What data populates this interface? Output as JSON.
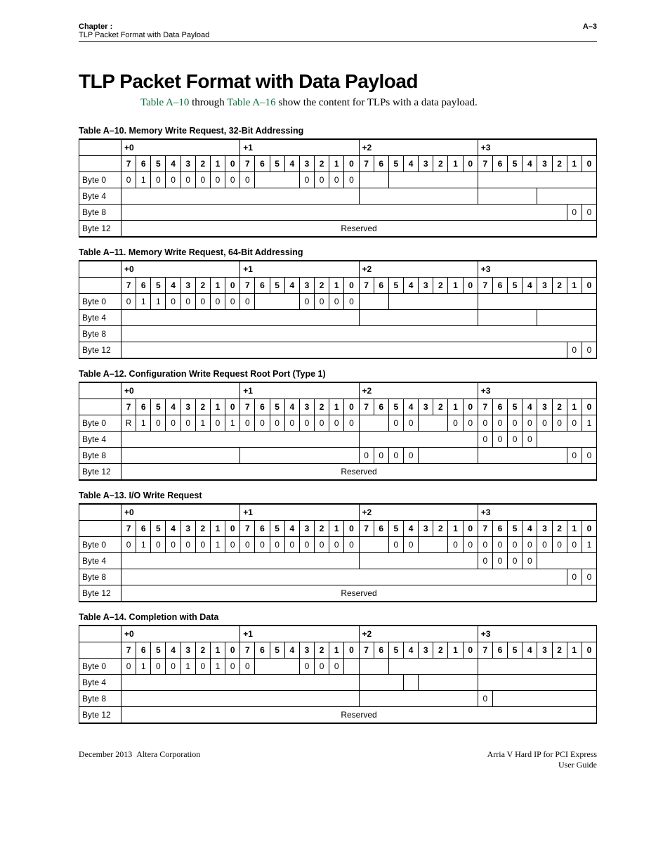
{
  "header": {
    "chapter": "Chapter :",
    "sub": "TLP Packet Format with Data Payload",
    "page": "A–3"
  },
  "title": "TLP Packet Format with Data Payload",
  "intro": {
    "ref1": "Table A–10",
    "mid": " through ",
    "ref2": "Table A–16",
    "rest": " show the content for TLPs with a data payload."
  },
  "byteGroups": [
    "+0",
    "+1",
    "+2",
    "+3"
  ],
  "bitLabels": [
    "7",
    "6",
    "5",
    "4",
    "3",
    "2",
    "1",
    "0"
  ],
  "rowLabels": [
    "Byte 0",
    "Byte 4",
    "Byte 8",
    "Byte 12"
  ],
  "reserved": "Reserved",
  "tables": {
    "a10": {
      "caption": "Table A–10.  Memory Write Request, 32-Bit Addressing",
      "byte0": {
        "plus0": [
          "0",
          "1",
          "0",
          "0",
          "0",
          "0",
          "0",
          "0"
        ],
        "plus1_hi": "0",
        "plus1_lo": [
          "0",
          "0",
          "0",
          "0"
        ]
      },
      "byte8_tail": [
        "0",
        "0"
      ]
    },
    "a11": {
      "caption": "Table A–11.  Memory Write Request, 64-Bit Addressing",
      "byte0": {
        "plus0": [
          "0",
          "1",
          "1",
          "0",
          "0",
          "0",
          "0",
          "0"
        ],
        "plus1_hi": "0",
        "plus1_lo": [
          "0",
          "0",
          "0",
          "0"
        ]
      },
      "byte12_tail": [
        "0",
        "0"
      ]
    },
    "a12": {
      "caption": "Table A–12.  Configuration Write Request Root Port (Type 1)",
      "byte0": {
        "plus0": [
          "R",
          "1",
          "0",
          "0",
          "0",
          "1",
          "0",
          "1"
        ],
        "plus1": [
          "0",
          "0",
          "0",
          "0",
          "0",
          "0",
          "0",
          "0"
        ],
        "plus2": [
          "",
          "",
          "0",
          "0",
          "",
          "",
          "0",
          "0"
        ],
        "plus3": [
          "0",
          "0",
          "0",
          "0",
          "0",
          "0",
          "0",
          "1"
        ]
      },
      "byte4_plus3": [
        "0",
        "0",
        "0",
        "0"
      ],
      "byte8_plus2": [
        "0",
        "0",
        "0",
        "0"
      ],
      "byte8_tail": [
        "0",
        "0"
      ]
    },
    "a13": {
      "caption": "Table A–13.  I/O Write Request",
      "byte0": {
        "plus0": [
          "0",
          "1",
          "0",
          "0",
          "0",
          "0",
          "1",
          "0"
        ],
        "plus1": [
          "0",
          "0",
          "0",
          "0",
          "0",
          "0",
          "0",
          "0"
        ],
        "plus2": [
          "",
          "",
          "0",
          "0",
          "",
          "",
          "0",
          "0"
        ],
        "plus3": [
          "0",
          "0",
          "0",
          "0",
          "0",
          "0",
          "0",
          "1"
        ]
      },
      "byte4_plus3": [
        "0",
        "0",
        "0",
        "0"
      ],
      "byte8_tail": [
        "0",
        "0"
      ]
    },
    "a14": {
      "caption": "Table A–14.  Completion with Data",
      "byte0": {
        "plus0": [
          "0",
          "1",
          "0",
          "0",
          "1",
          "0",
          "1",
          "0"
        ],
        "plus1_hi": "0",
        "plus1_lo": [
          "0",
          "0",
          "0"
        ]
      },
      "byte8_plus3_hi": "0"
    }
  },
  "footer": {
    "left": "December 2013  Altera Corporation",
    "right1": "Arria V Hard IP for PCI Express",
    "right2": "User Guide"
  }
}
